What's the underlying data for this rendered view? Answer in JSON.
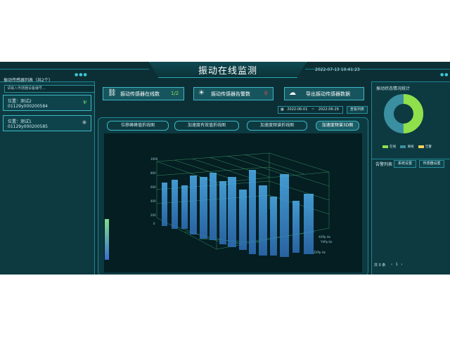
{
  "header": {
    "title": "振动在线监测",
    "datetime": "2022-07-13 10:41:23"
  },
  "sensor_list": {
    "title": "振动传感器列表（共2个）",
    "search_placeholder": "请输入传感器设备编号...",
    "items": [
      {
        "location": "位置：测试2",
        "device_id": "01129y000200584"
      },
      {
        "location": "位置：测试1",
        "device_id": "01129y000200585"
      }
    ]
  },
  "stats": {
    "online_label": "振动传感器在线数",
    "online_value": "1/2",
    "alarm_label": "振动传感器告警数",
    "alarm_value": "0",
    "export_label": "导出振动传感器数据"
  },
  "date_range": {
    "start": "2022-06-01",
    "sep": "~",
    "end": "2022-06-29",
    "query_label": "查看列表"
  },
  "chart_tabs": [
    "位移峰峰值折线图",
    "加速度有效值折线图",
    "加速度频谱折线图",
    "加速度频谱3D图"
  ],
  "chart3d": {
    "axis_labels": [
      "XVPp Hz",
      "YVPp Hz",
      "ZVPp Hz"
    ],
    "y_ticks": [
      "1000",
      "800",
      "600",
      "400",
      "200",
      "0"
    ]
  },
  "status_panel": {
    "title": "振动状态情况统计",
    "legend": [
      "在线",
      "离线",
      "告警"
    ],
    "colors": {
      "online": "#8fe04a",
      "offline": "#3a8fa0",
      "alarm": "#f0d25a"
    },
    "values": {
      "online": 1,
      "offline": 1,
      "alarm": 0
    }
  },
  "alarm_panel": {
    "title": "告警列表",
    "btn_system": "系统设置",
    "btn_sensor": "传感器设置",
    "total": "共 0 条",
    "page": "1"
  }
}
